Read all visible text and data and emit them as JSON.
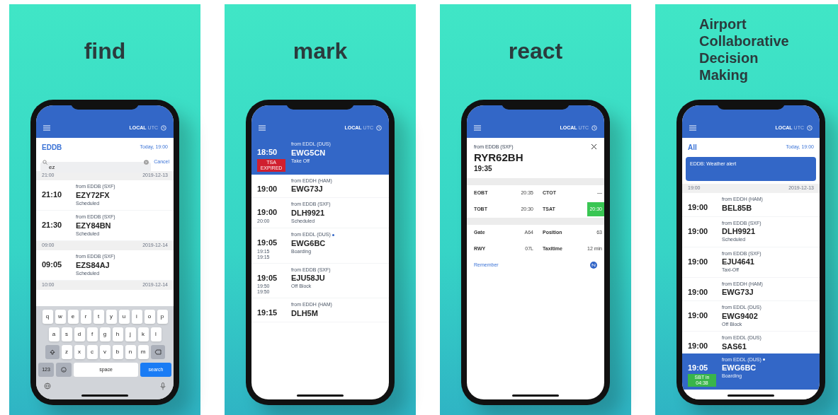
{
  "panels": [
    {
      "title_lines": [
        "find"
      ],
      "screen": {
        "kind": "search",
        "header": {
          "local": "LOCAL",
          "utc": "UTC"
        },
        "filter": "EDDB",
        "date": "Today, 19:00",
        "search": {
          "value": "ez",
          "cancel": "Cancel"
        },
        "sections": [
          {
            "time": "21:00",
            "date": "2019-12-13",
            "flights": [
              {
                "time": "21:10",
                "route": "from EDDB (SXF)",
                "callsign": "EZY72FX",
                "status": "Scheduled",
                "selected": false,
                "tracked": false
              },
              {
                "time": "21:30",
                "route": "from EDDB (SXF)",
                "callsign": "EZY84BN",
                "status": "Scheduled",
                "selected": false,
                "tracked": false
              }
            ]
          },
          {
            "time": "09:00",
            "date": "2019-12-14",
            "flights": [
              {
                "time": "09:05",
                "route": "from EDDB (SXF)",
                "callsign": "EZS84AJ",
                "status": "Scheduled",
                "selected": false,
                "tracked": false
              }
            ]
          },
          {
            "time": "10:00",
            "date": "2019-12-14"
          }
        ],
        "keyboard": {
          "rows": [
            [
              "q",
              "w",
              "e",
              "r",
              "t",
              "y",
              "u",
              "i",
              "o",
              "p"
            ],
            [
              "a",
              "s",
              "d",
              "f",
              "g",
              "h",
              "j",
              "k",
              "l"
            ],
            [
              "z",
              "x",
              "c",
              "v",
              "b",
              "n",
              "m"
            ]
          ],
          "numbers": "123",
          "space": "space",
          "action": "search"
        }
      }
    },
    {
      "title_lines": [
        "mark"
      ],
      "screen": {
        "kind": "list",
        "header": {
          "local": "LOCAL",
          "utc": "UTC"
        },
        "flights": [
          {
            "time": "18:50",
            "route": "from EDDL (DUS)",
            "callsign": "EWG5CN",
            "status": "Take Off",
            "badge": "TSA EXPIRED",
            "selected": true,
            "tracked": false
          },
          {
            "time": "19:00",
            "route": "from EDDH (HAM)",
            "callsign": "EWG73J",
            "selected": false,
            "tracked": false
          },
          {
            "time": "19:00",
            "times": [
              "20:00"
            ],
            "route": "from EDDB (SXF)",
            "callsign": "DLH9921",
            "status": "Scheduled",
            "selected": false,
            "tracked": false
          },
          {
            "time": "19:05",
            "times": [
              "19:15",
              "19:15"
            ],
            "route": "from EDDL (DUS)",
            "callsign": "EWG6BC",
            "status": "Boarding",
            "selected": false,
            "tracked": true
          },
          {
            "time": "19:05",
            "times": [
              "19:50",
              "19:50"
            ],
            "route": "from EDDB (SXF)",
            "callsign": "EJU58JU",
            "status": "Off Block",
            "selected": false,
            "tracked": false
          },
          {
            "time": "19:15",
            "route": "from EDDH (HAM)",
            "callsign": "DLH5M",
            "selected": false,
            "tracked": false
          }
        ]
      }
    },
    {
      "title_lines": [
        "react"
      ],
      "screen": {
        "kind": "detail",
        "header": {
          "local": "LOCAL",
          "utc": "UTC"
        },
        "route": "from EDDB (SXF)",
        "callsign": "RYR62BH",
        "time": "19:35",
        "groups": [
          {
            "rows": [
              [
                {
                  "label": "EOBT",
                  "value": "20:35",
                  "highlight": false
                },
                {
                  "label": "CTOT",
                  "value": "—",
                  "highlight": false
                }
              ],
              [
                {
                  "label": "TOBT",
                  "value": "20:30",
                  "highlight": false
                },
                {
                  "label": "TSAT",
                  "value": "20:30",
                  "highlight": true
                }
              ]
            ]
          },
          {
            "rows": [
              [
                {
                  "label": "Gate",
                  "value": "A64",
                  "highlight": false
                },
                {
                  "label": "Position",
                  "value": "63",
                  "highlight": false
                }
              ],
              [
                {
                  "label": "RWY",
                  "value": "07L",
                  "highlight": false
                },
                {
                  "label": "Taxitime",
                  "value": "12 min",
                  "highlight": false
                }
              ]
            ]
          }
        ],
        "remember": "Remember"
      }
    },
    {
      "title_lines": [
        "Airport",
        "Collaborative",
        "Decision",
        "Making"
      ],
      "screen": {
        "kind": "alerts",
        "header": {
          "local": "LOCAL",
          "utc": "UTC"
        },
        "filter": "All",
        "date": "Today, 19:00",
        "alert": {
          "title": "EDDB: Weather alert"
        },
        "sections": [
          {
            "time": "19:00",
            "date": "2019-12-13",
            "flights": [
              {
                "time": "19:00",
                "route": "from EDDH (HAM)",
                "callsign": "BEL85B",
                "selected": false,
                "tracked": false
              },
              {
                "time": "19:00",
                "route": "from EDDB (SXF)",
                "callsign": "DLH9921",
                "status": "Scheduled",
                "selected": false,
                "tracked": false
              },
              {
                "time": "19:00",
                "route": "from EDDB (SXF)",
                "callsign": "EJU4641",
                "status": "Taxi-Off",
                "selected": false,
                "tracked": false
              },
              {
                "time": "19:00",
                "route": "from EDDH (HAM)",
                "callsign": "EWG73J",
                "selected": false,
                "tracked": false
              },
              {
                "time": "19:00",
                "route": "from EDDL (DUS)",
                "callsign": "EWG9402",
                "status": "Off Block",
                "selected": false,
                "tracked": false
              },
              {
                "time": "19:00",
                "route": "from EDDL (DUS)",
                "callsign": "SAS61",
                "selected": false,
                "tracked": false
              }
            ]
          }
        ],
        "pinned": {
          "time": "19:05",
          "route": "from EDDL (DUS)",
          "callsign": "EWG6BC",
          "status": "Boarding",
          "badge": "SBT in 04:38",
          "selected": true,
          "tracked": true
        }
      }
    }
  ]
}
